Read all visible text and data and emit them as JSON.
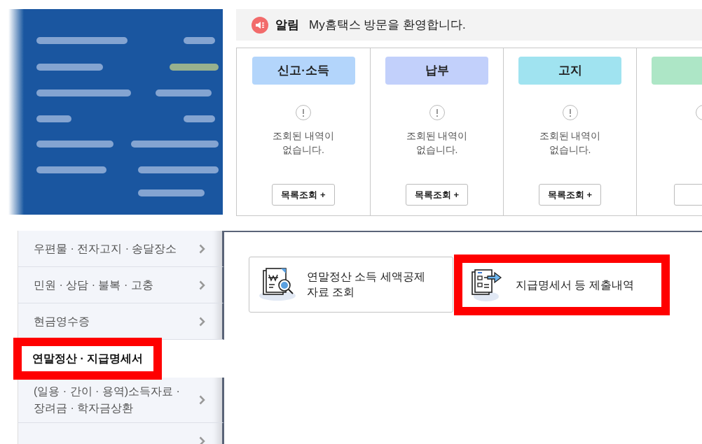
{
  "notice": {
    "label": "알림",
    "message": "My홈택스 방문을 환영합니다."
  },
  "summary_cards": [
    {
      "title": "신고·소득",
      "color": "#b3d5fb",
      "message": [
        "조회된 내역이",
        "없습니다."
      ],
      "button": "목록조회 +"
    },
    {
      "title": "납부",
      "color": "#c2d0fb",
      "message": [
        "조회된 내역이",
        "없습니다."
      ],
      "button": "목록조회 +"
    },
    {
      "title": "고지",
      "color": "#a0e3f0",
      "message": [
        "조회된 내역이",
        "없습니다."
      ],
      "button": "목록조회 +"
    },
    {
      "color": "#ade6c6"
    }
  ],
  "sidebar": {
    "items": [
      {
        "lines": [
          "우편물 · 전자고지 · 송달장소"
        ],
        "selected": false,
        "highlighted": false
      },
      {
        "lines": [
          "민원 · 상담 · 불복 · 고충"
        ],
        "selected": false,
        "highlighted": false
      },
      {
        "lines": [
          "현금영수증"
        ],
        "selected": false,
        "highlighted": false
      },
      {
        "lines": [
          "연말정산 · 지급명세서"
        ],
        "selected": true,
        "highlighted": true
      },
      {
        "lines": [
          "(일용 · 간이 · 용역)소득자료 ·",
          "장려금 · 학자금상환"
        ],
        "selected": false,
        "highlighted": false
      },
      {
        "selected": false,
        "highlighted": false
      }
    ]
  },
  "actions": [
    {
      "kind": "search",
      "lines": [
        "연말정산 소득 세액공제",
        "자료 조회"
      ],
      "highlighted": false
    },
    {
      "kind": "submit",
      "lines": [
        "지급명세서 등 제출내역"
      ],
      "highlighted": true
    }
  ]
}
